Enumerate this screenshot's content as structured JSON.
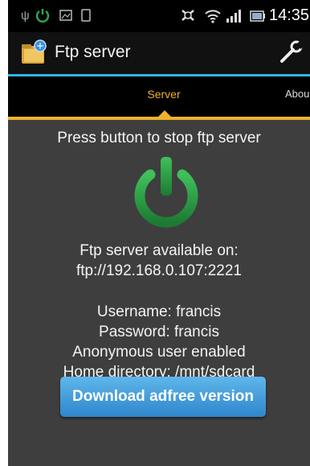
{
  "status_bar": {
    "time": "14:35",
    "icons": [
      "usb-icon",
      "power-icon",
      "image-icon",
      "phone-icon",
      "alarm-icon",
      "wifi-icon",
      "signal-icon",
      "battery-icon"
    ]
  },
  "action_bar": {
    "title": "Ftp server",
    "app_icon": "folder-icon",
    "settings_icon": "wrench-icon"
  },
  "tabs": [
    {
      "label": "Server",
      "selected": true
    },
    {
      "label": "Abou",
      "selected": false
    }
  ],
  "content": {
    "instruction": "Press button to stop ftp server",
    "power_icon": "power-icon",
    "available_label": "Ftp server available on:",
    "url": "ftp://192.168.0.107:2221",
    "username": "Username: francis",
    "password": "Password: francis",
    "anonymous": "Anonymous user enabled",
    "home_directory": "Home directory: /mnt/sdcard"
  },
  "download_button": {
    "label": "Download adfree version"
  },
  "colors": {
    "accent_blue": "#33b5e5",
    "tab_accent": "#f0b12b",
    "power_green": "#2ea44a",
    "button_blue": "#3c96d8",
    "content_bg": "#3e3e3e"
  }
}
